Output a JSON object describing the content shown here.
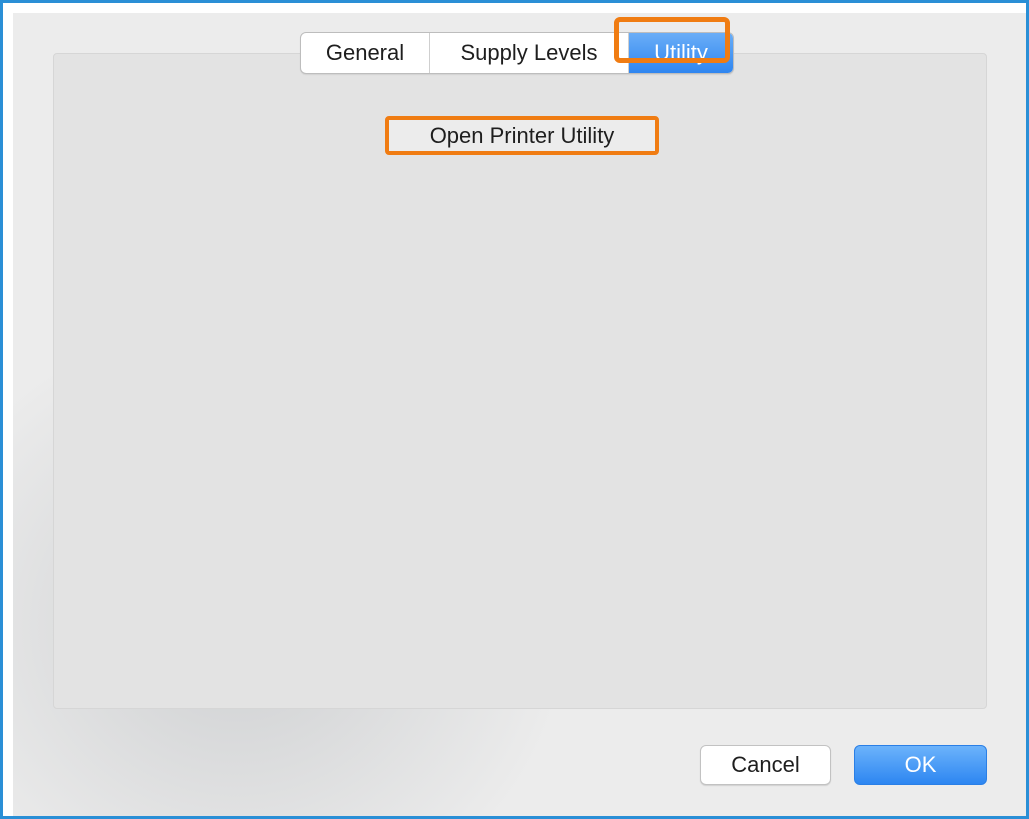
{
  "tabs": [
    {
      "label": "General",
      "selected": false
    },
    {
      "label": "Supply Levels",
      "selected": false
    },
    {
      "label": "Utility",
      "selected": true
    }
  ],
  "utility_panel": {
    "open_printer_utility_label": "Open Printer Utility"
  },
  "footer": {
    "cancel_label": "Cancel",
    "ok_label": "OK"
  },
  "colors": {
    "accent": "#2f86f0",
    "highlight": "#f07c12",
    "frame_border": "#2a8fd6"
  }
}
